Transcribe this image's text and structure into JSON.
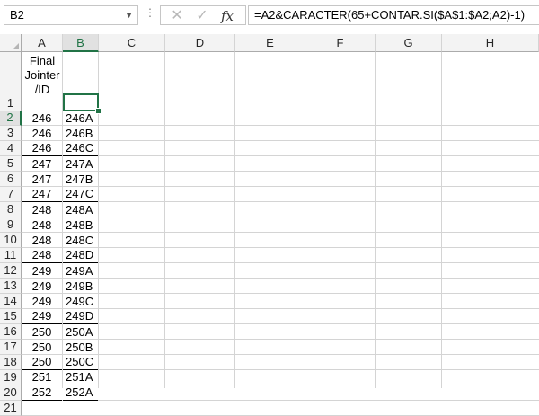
{
  "formula_bar": {
    "name_box": "B2",
    "formula": "=A2&CARACTER(65+CONTAR.SI($A$1:$A2;A2)-1)"
  },
  "columns": [
    "A",
    "B",
    "C",
    "D",
    "E",
    "F",
    "G",
    "H"
  ],
  "header_cell": [
    "Final",
    "Jointer",
    "/ID"
  ],
  "rows": [
    "1",
    "2",
    "3",
    "4",
    "5",
    "6",
    "7",
    "8",
    "9",
    "10",
    "11",
    "12",
    "13",
    "14",
    "15",
    "16",
    "17",
    "18",
    "19",
    "20",
    "21"
  ],
  "col_a": [
    "246",
    "246",
    "246",
    "247",
    "247",
    "247",
    "248",
    "248",
    "248",
    "248",
    "249",
    "249",
    "249",
    "249",
    "250",
    "250",
    "250",
    "251",
    "252"
  ],
  "col_b": [
    "246A",
    "246B",
    "246C",
    "247A",
    "247B",
    "247C",
    "248A",
    "248B",
    "248C",
    "248D",
    "249A",
    "249B",
    "249C",
    "249D",
    "250A",
    "250B",
    "250C",
    "251A",
    "252A"
  ],
  "selected_cell": "B2",
  "accent_color": "#217346"
}
